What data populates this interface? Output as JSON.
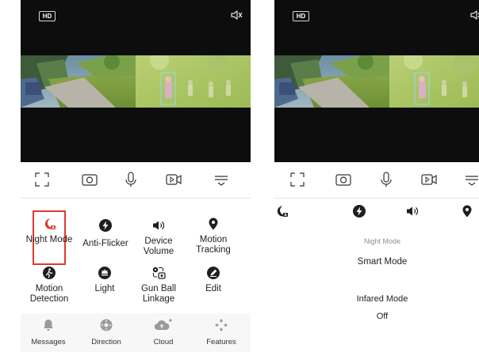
{
  "left_screen": {
    "video": {
      "hd_label": "HD",
      "mute_icon": "speaker-muted-icon"
    },
    "toolbar": {
      "icons": [
        "fullscreen-icon",
        "snapshot-icon",
        "microphone-icon",
        "record-video-icon",
        "menu-icon"
      ]
    },
    "features": [
      {
        "label": "Night Mode",
        "icon": "night-mode-icon",
        "highlighted": true,
        "highlight_color": "#e03a2f"
      },
      {
        "label": "Anti-Flicker",
        "icon": "anti-flicker-icon"
      },
      {
        "label": "Device Volume",
        "icon": "volume-icon"
      },
      {
        "label": "Motion Tracking",
        "icon": "location-pin-icon"
      },
      {
        "label": "Motion Detection",
        "icon": "motion-detection-icon"
      },
      {
        "label": "Light",
        "icon": "light-icon"
      },
      {
        "label": "Gun Ball Linkage",
        "icon": "gun-ball-linkage-icon"
      },
      {
        "label": "Edit",
        "icon": "edit-icon"
      }
    ],
    "bottom_nav": [
      {
        "label": "Messages",
        "icon": "bell-icon"
      },
      {
        "label": "Direction",
        "icon": "direction-pad-icon"
      },
      {
        "label": "Cloud",
        "icon": "cloud-icon"
      },
      {
        "label": "Features",
        "icon": "features-icon"
      }
    ]
  },
  "right_screen": {
    "video": {
      "hd_label": "HD",
      "mute_icon": "speaker-muted-icon"
    },
    "toolbar": {
      "icons": [
        "fullscreen-icon",
        "snapshot-icon",
        "microphone-icon",
        "record-video-icon",
        "menu-icon"
      ]
    },
    "feature_icons": [
      "night-mode-icon",
      "anti-flicker-icon",
      "volume-icon",
      "location-pin-icon"
    ],
    "panel": {
      "section_title": "Night Mode",
      "current_mode": "Smart Mode",
      "infrared_label": "Infared Mode",
      "infrared_value": "Off"
    }
  },
  "colors": {
    "accent_red": "#e03a2f",
    "icon_dark": "#1f1f1f",
    "video_bg": "#0d0d0d"
  }
}
